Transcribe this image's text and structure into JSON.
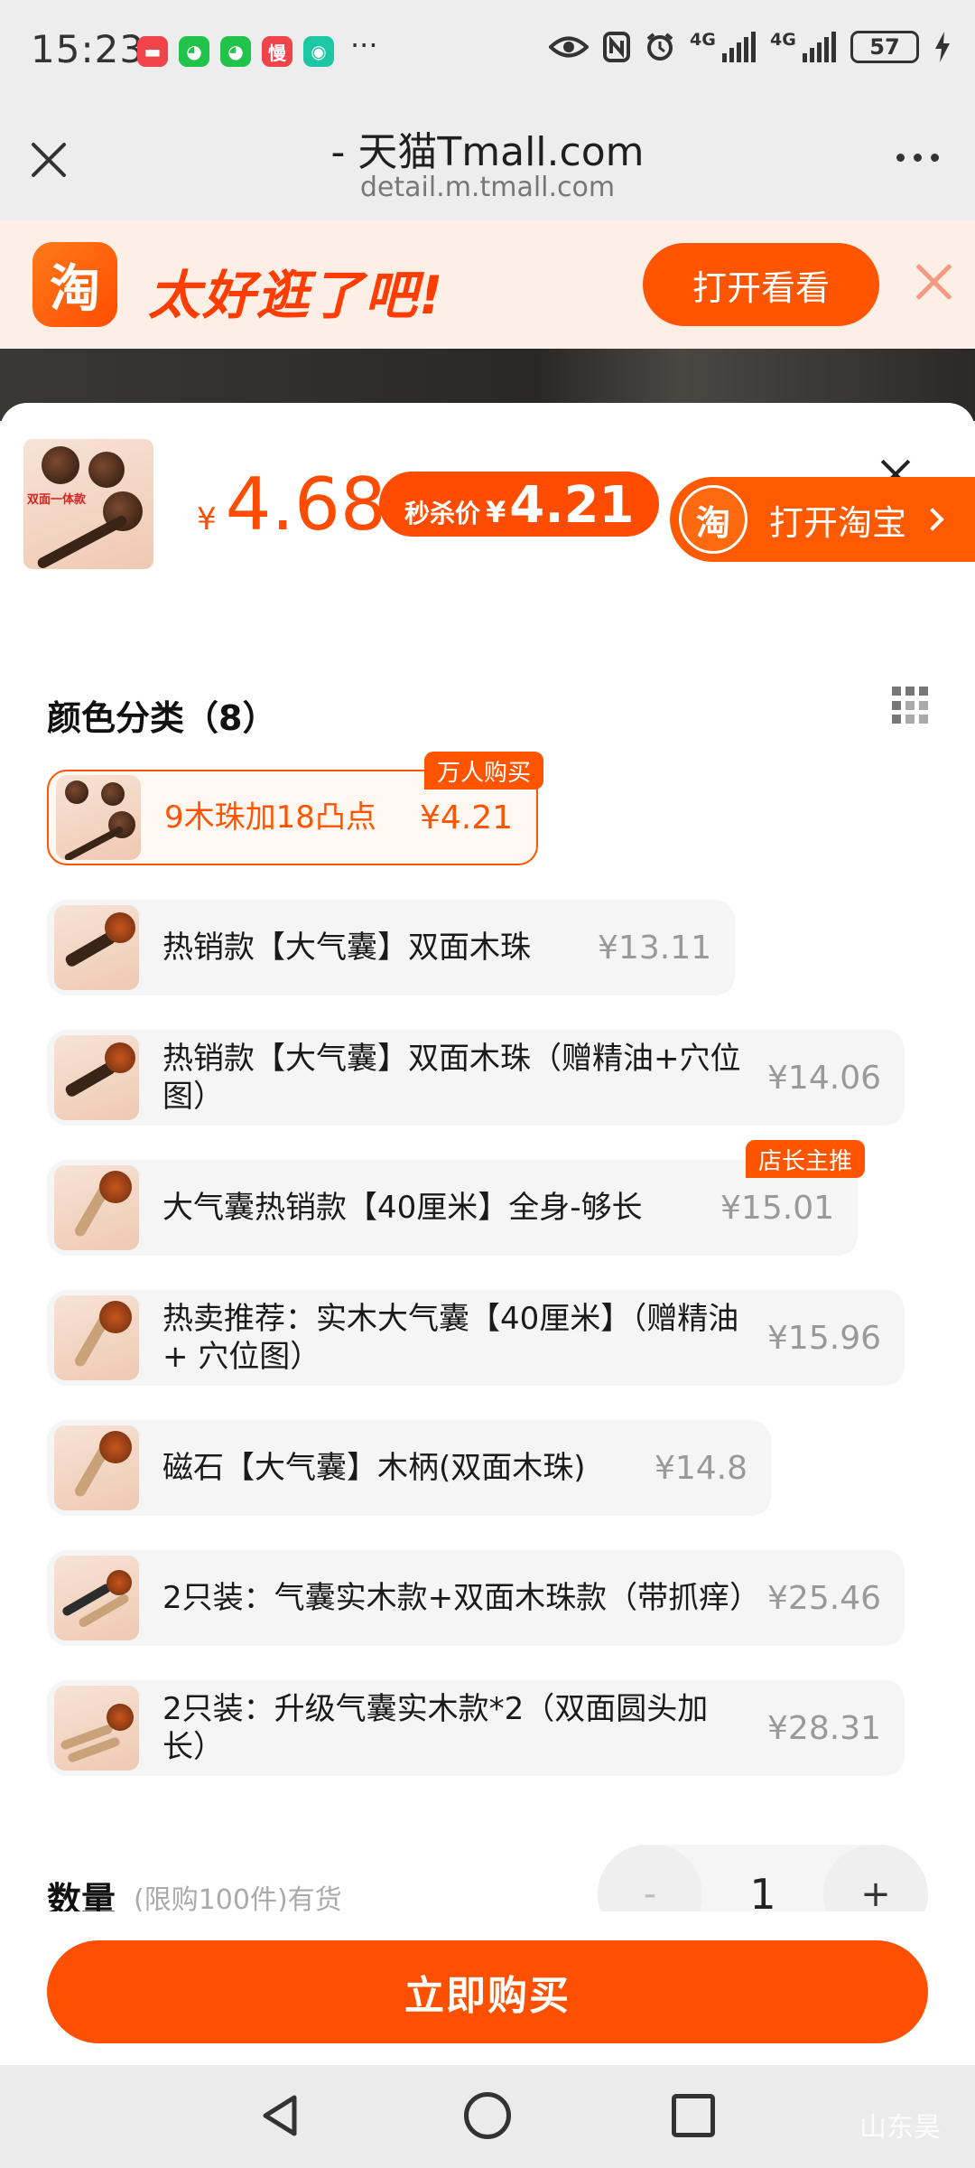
{
  "status_bar": {
    "time": "15:23",
    "more": "···",
    "signal_1": "4G",
    "signal_2": "4G",
    "battery": "57"
  },
  "browser": {
    "title": "- 天猫Tmall.com",
    "url": "detail.m.tmall.com"
  },
  "banner": {
    "logo_text": "淘",
    "slogan": "太好逛了吧!",
    "open_button": "打开看看"
  },
  "product": {
    "currency": "¥",
    "price": "4.68",
    "seckill_label": "秒杀价",
    "seckill_price": "4.21",
    "open_taobao": "打开淘宝",
    "thumb_label": "双面一体款"
  },
  "variants": {
    "title": "颜色分类（8）",
    "items": [
      {
        "name": "9木珠加18凸点",
        "price": "¥4.21",
        "tag": "万人购买"
      },
      {
        "name": "热销款【大气囊】双面木珠",
        "price": "¥13.11"
      },
      {
        "name": "热销款【大气囊】双面木珠（赠精油+穴位图）",
        "price": "¥14.06"
      },
      {
        "name": "大气囊热销款【40厘米】全身-够长",
        "price": "¥15.01",
        "tag": "店长主推"
      },
      {
        "name": "热卖推荐：实木大气囊【40厘米】（赠精油+ 穴位图）",
        "price": "¥15.96"
      },
      {
        "name": "磁石【大气囊】木柄(双面木珠)",
        "price": "¥14.8"
      },
      {
        "name": "2只装：气囊实木款+双面木珠款（带抓痒）",
        "price": "¥25.46"
      },
      {
        "name": "2只装：升级气囊实木款*2（双面圆头加长）",
        "price": "¥28.31"
      }
    ]
  },
  "quantity": {
    "label": "数量",
    "note": "(限购100件)有货",
    "minus": "-",
    "value": "1",
    "plus": "+"
  },
  "buy_button": "立即购买",
  "watermark": "山东昊",
  "colors": {
    "accent": "#ff5500",
    "price": "#ff4c00",
    "banner_bg": "#fdeee6"
  }
}
